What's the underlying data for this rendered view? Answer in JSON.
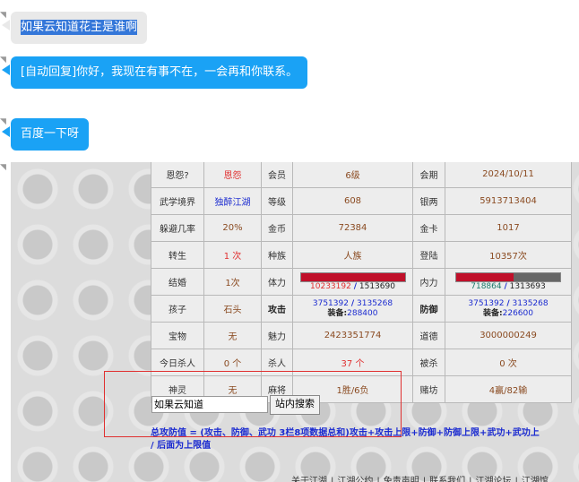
{
  "chat": {
    "msg1": {
      "text": "如果云知道花主是谁啊"
    },
    "msg2": {
      "text": "[自动回复]你好，我现在有事不在，一会再和你联系。"
    },
    "msg3": {
      "text": "百度一下呀"
    }
  },
  "stats": {
    "rows": [
      [
        "恩怨?",
        "恩怨",
        "会员",
        "6级",
        "会期",
        "2024/10/11"
      ],
      [
        "武学境界",
        "独醉江湖",
        "等级",
        "608",
        "银两",
        "5913713404"
      ],
      [
        "躲避几率",
        "20%",
        "金币",
        "72384",
        "金卡",
        "1017"
      ],
      [
        "转生",
        "1 次",
        "种族",
        "人族",
        "登陆",
        "10357次"
      ]
    ],
    "marriage_label": "结婚",
    "marriage_value": "1次",
    "hp_label": "体力",
    "hp_current": "10233192",
    "hp_sep": "/",
    "hp_max": "1513690",
    "hp_fraction": 1.0,
    "mp_label": "内力",
    "mp_current": "718864",
    "mp_sep": "/",
    "mp_max": "1313693",
    "mp_fraction": 0.55,
    "child_label": "孩子",
    "child_value": "石头",
    "atk_label": "攻击",
    "atk_a": "3751392",
    "atk_sep": "/",
    "atk_b": "3135268",
    "atk_equip_label": "装备:",
    "atk_equip": "288400",
    "def_label": "防御",
    "def_a": "3751392",
    "def_sep": "/",
    "def_b": "3135268",
    "def_equip_label": "装备:",
    "def_equip": "226600",
    "rows2": [
      [
        "宝物",
        "无",
        "魅力",
        "2423351774",
        "道德",
        "3000000249"
      ],
      [
        "今日杀人",
        "0 个",
        "杀人",
        "37 个",
        "被杀",
        "0 次"
      ],
      [
        "神灵",
        "无",
        "麻将",
        "1胜/6负",
        "赌坊",
        "4赢/82输"
      ]
    ]
  },
  "search": {
    "input_value": "如果云知道",
    "button_label": "站内搜索"
  },
  "formula": {
    "line1": "总攻防值 = (攻击、防御、武功 3栏8项数据总和)攻击+攻击上限+防御+防御上限+武功+武功上",
    "line2": "/ 后面为上限值"
  },
  "footer": {
    "links": [
      "关于江湖",
      "|",
      "江湖公约",
      "|",
      "免责声明",
      "|",
      "联系我们",
      "|",
      "江湖论坛",
      "|",
      "江湖馆"
    ]
  },
  "colors": {
    "bubble_blue": "#1aa2f5",
    "selection": "#3477d9",
    "hp_bar": "#c0102a"
  }
}
